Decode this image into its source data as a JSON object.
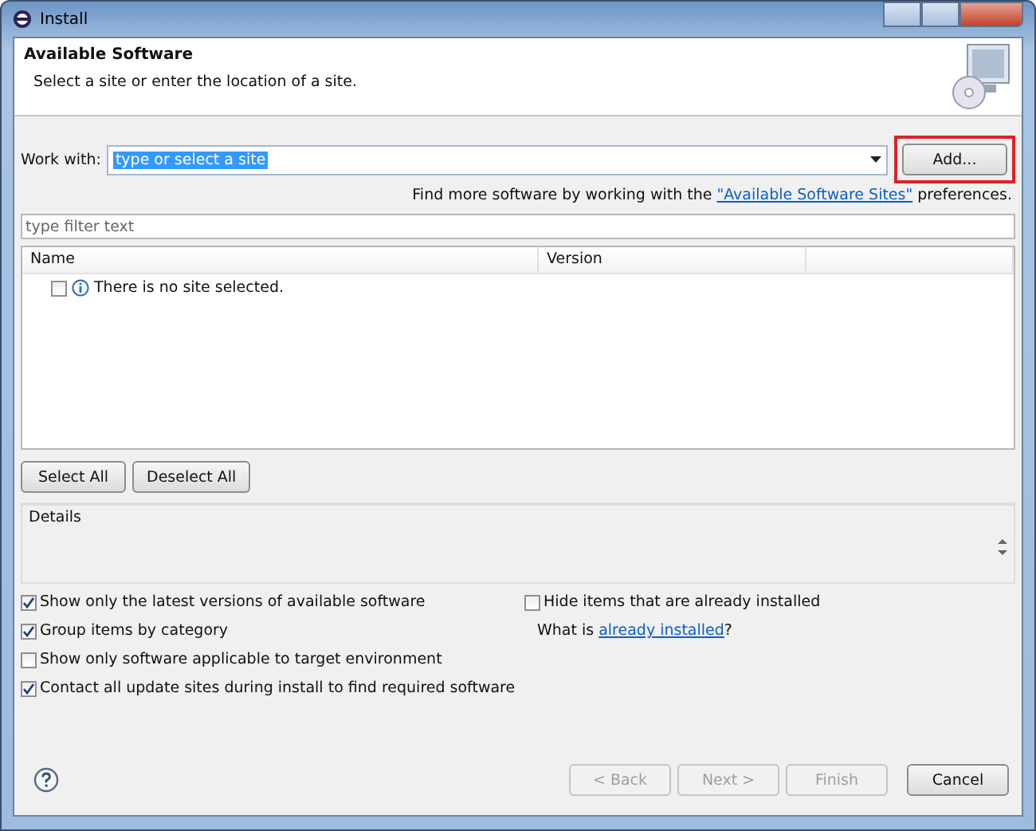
{
  "window": {
    "title": "Install"
  },
  "header": {
    "title": "Available Software",
    "description": "Select a site or enter the location of a site."
  },
  "work_with": {
    "label": "Work with:",
    "value": "type or select a site",
    "add_button": {
      "label": "Add...",
      "highlighted": true
    }
  },
  "sites_hint": {
    "before": "Find more software by working with the ",
    "link": "\"Available Software Sites\"",
    "after": " preferences."
  },
  "filter": {
    "placeholder": "type filter text"
  },
  "table": {
    "columns": [
      "Name",
      "Version"
    ],
    "rows": [
      {
        "name": "There is no site selected.",
        "checked": false
      }
    ]
  },
  "selection_buttons": [
    "Select All",
    "Deselect All"
  ],
  "details": {
    "label": "Details"
  },
  "options_left": [
    {
      "label": "Show only the latest versions of available software",
      "checked": true
    },
    {
      "label": "Group items by category",
      "checked": true
    },
    {
      "label": "Show only software applicable to target environment",
      "checked": false
    },
    {
      "label": "Contact all update sites during install to find required software",
      "checked": true
    }
  ],
  "options_right": {
    "hide_installed": {
      "label": "Hide items that are already installed",
      "checked": false
    },
    "installed": {
      "before": "What is ",
      "link": "already installed",
      "after": "?"
    }
  },
  "footer_buttons": [
    {
      "label": "< Back",
      "disabled": true
    },
    {
      "label": "Next >",
      "disabled": true
    },
    {
      "label": "Finish",
      "disabled": true
    },
    {
      "label": "Cancel",
      "disabled": false
    }
  ]
}
